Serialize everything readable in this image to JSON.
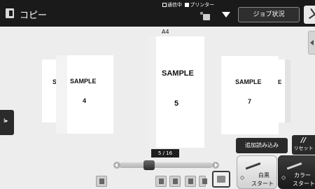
{
  "header": {
    "app_title": "コピー",
    "status_labels": [
      "通信中",
      "プリンター"
    ],
    "job_status_button": "ジョブ状況",
    "icons": [
      "copy-icon",
      "printer-icon",
      "dropdown-arrow-icon",
      "settings-icon"
    ]
  },
  "preview": {
    "paper_size": "A4",
    "pages": [
      {
        "label": "S",
        "number": ""
      },
      {
        "label": "SAMPLE",
        "number": "4"
      },
      {
        "label": "SAMPLE",
        "number": "5"
      },
      {
        "label": "SAMPLE",
        "number": "7"
      },
      {
        "label": "E",
        "number": ""
      }
    ]
  },
  "controls": {
    "additional_scan_button": "追加読み込み",
    "reset_button": {
      "icon": "//",
      "label": "リセット"
    },
    "page_counter": "5 / 16",
    "slider_position_fraction": 0.3
  },
  "start_buttons": {
    "bw": {
      "line1": "白黒",
      "line2": "スタート"
    },
    "color": {
      "line1": "カラー",
      "line2": "スタート"
    }
  }
}
